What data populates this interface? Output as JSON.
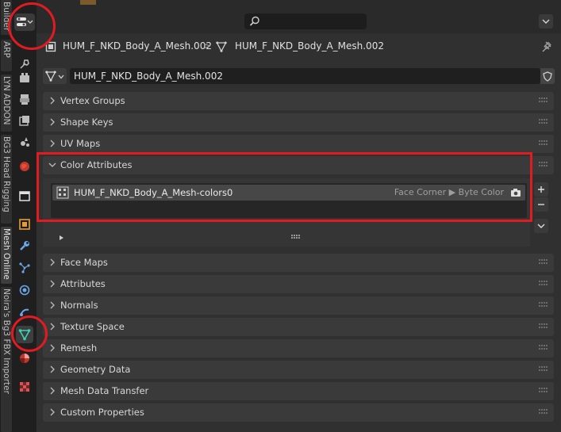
{
  "side_tabs": [
    "Builder",
    "ARP",
    "LYN ADDON",
    "BG3 Head Rigging",
    "Mesh Online",
    "Noira's Bg3 FBX Importer"
  ],
  "icons": [
    "tool-icon",
    "render-icon",
    "output-icon",
    "view-layer-icon",
    "scene-icon",
    "world-icon",
    "collection-icon",
    "object-icon",
    "modifier-icon",
    "particles-icon",
    "physics-icon",
    "constraints-icon",
    "object-data-icon",
    "material-icon",
    "texture-icon"
  ],
  "breadcrumb": {
    "object": "HUM_F_NKD_Body_A_Mesh.002",
    "separator": ">",
    "mesh": "HUM_F_NKD_Body_A_Mesh.002"
  },
  "mesh_name": "HUM_F_NKD_Body_A_Mesh.002",
  "panels_top": [
    "Vertex Groups",
    "Shape Keys",
    "UV Maps"
  ],
  "color_attributes": {
    "title": "Color Attributes",
    "items": [
      {
        "name": "HUM_F_NKD_Body_A_Mesh-colors0",
        "type": "Face Corner ▶ Byte Color"
      }
    ]
  },
  "panels_bottom": [
    "Face Maps",
    "Attributes",
    "Normals",
    "Texture Space",
    "Remesh",
    "Geometry Data",
    "Mesh Data Transfer",
    "Custom Properties"
  ],
  "colors": {
    "highlight": "#e11b22",
    "active_icon": "#39d3b4"
  }
}
